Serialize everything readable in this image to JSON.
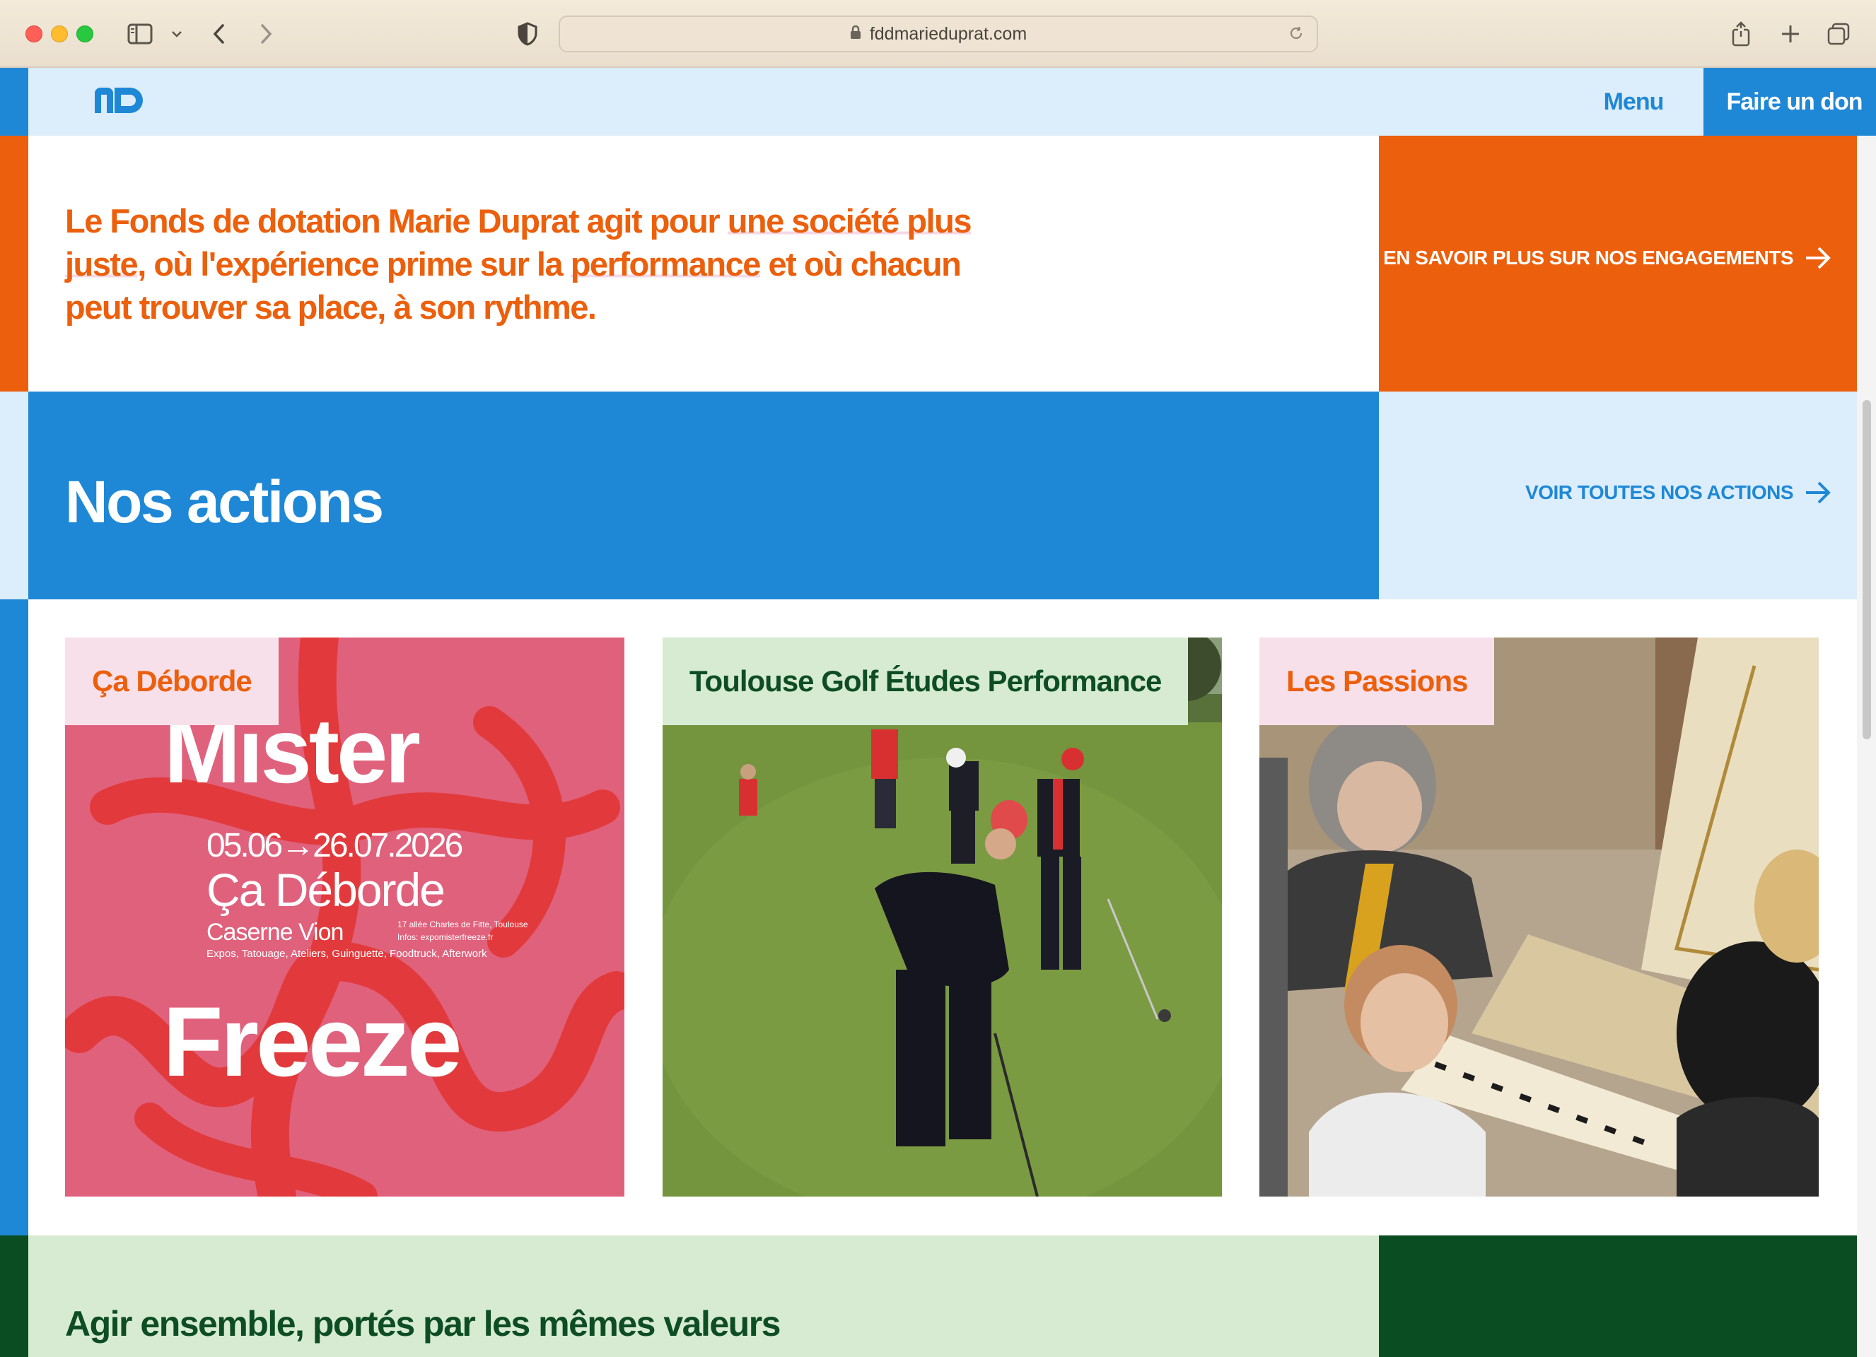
{
  "browser": {
    "url": "fddmarieduprat.com",
    "icons": [
      "sidebar-icon",
      "chevron-down-icon",
      "back-icon",
      "forward-icon",
      "shield-icon",
      "lock-icon",
      "reload-icon",
      "share-icon",
      "plus-icon",
      "tabs-icon"
    ]
  },
  "header": {
    "logo_alt": "MD",
    "menu_label": "Menu",
    "donate_label": "Faire un don"
  },
  "intro": {
    "text_part1": "Le Fonds de dotation Marie Duprat agit pour ",
    "text_hl1": "une société plus juste",
    "text_part2": ", où l'expérience prime sur la ",
    "text_hl2": "performance",
    "text_part3": " et où chacun peut trouver sa place, à son rythme.",
    "cta_label": "En savoir plus sur nos engagements"
  },
  "actions": {
    "title": "Nos actions",
    "cta_label": "Voir toutes nos actions",
    "cards": [
      {
        "label": "Ça Déborde",
        "poster_top": "Mister",
        "poster_dates": "05.06→26.07.2026",
        "poster_title": "Ça Déborde",
        "poster_venue": "Caserne Vion",
        "poster_address": "17 allée Charles de Fitte, Toulouse",
        "poster_info": "Infos: expomisterfreeze.fr",
        "poster_tags": "Expos, Tatouage, Ateliers, Guinguette, Foodtruck, Afterwork",
        "poster_bottom": "Freeze"
      },
      {
        "label": "Toulouse Golf Études Performance"
      },
      {
        "label": "Les Passions"
      }
    ]
  },
  "values": {
    "title": "Agir ensemble, portés par les mêmes valeurs"
  },
  "colors": {
    "orange": "#ec5f0c",
    "blue": "#1f88d6",
    "light_blue": "#dcedfb",
    "dark_green": "#0b4d22",
    "light_green": "#d6ebd2",
    "pink": "#f8e0ea"
  }
}
